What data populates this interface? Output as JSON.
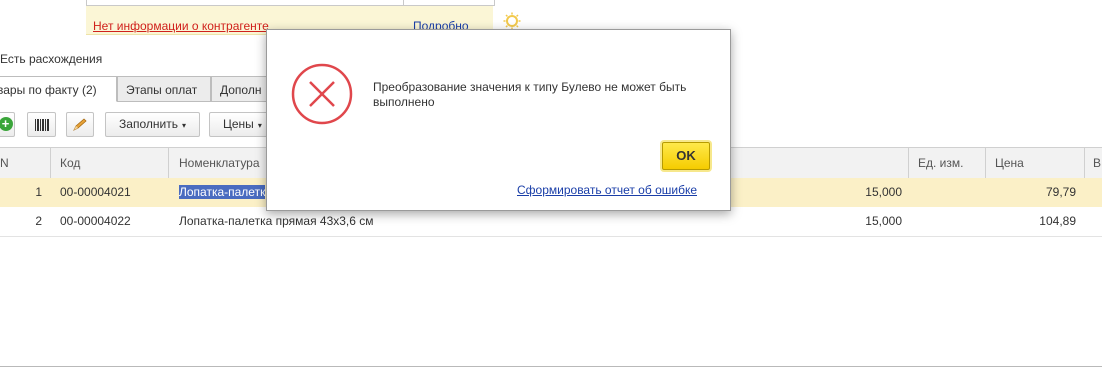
{
  "counterparty": {
    "no_info": "Нет информации о контрагенте",
    "details": "Подробно"
  },
  "discrepancy_label": "Есть расхождения",
  "tabs": [
    {
      "label": "вары по факту (2)",
      "active": true
    },
    {
      "label": "Этапы оплат",
      "active": false
    },
    {
      "label": "Дополн",
      "active": false
    }
  ],
  "toolbar": {
    "fill_label": "Заполнить",
    "prices_label": "Цены",
    "caret": "▾"
  },
  "table": {
    "headers": {
      "n": "N",
      "code": "Код",
      "nomenclature": "Номенклатура",
      "unit": "Ед. изм.",
      "price": "Цена",
      "extra": "В"
    },
    "rows": [
      {
        "n": "1",
        "code": "00-00004021",
        "name": "Лопатка-палетк",
        "qty": "15,000",
        "unit": "",
        "price": "79,79",
        "selected": true
      },
      {
        "n": "2",
        "code": "00-00004022",
        "name": "Лопатка-палетка прямая 43х3,6 см",
        "qty": "15,000",
        "unit": "",
        "price": "104,89",
        "selected": false
      }
    ]
  },
  "dialog": {
    "message": "Преобразование значения к типу Булево не может быть выполнено",
    "ok_label": "OK",
    "report_link": "Сформировать отчет об ошибке",
    "icon": "error-icon"
  },
  "colors": {
    "error_red": "#d0211c",
    "link_blue": "#1a3ea8",
    "ok_yellow": "#f5cc00",
    "selected_row": "#fbf0c7",
    "selection_blue": "#4a6cc0"
  }
}
